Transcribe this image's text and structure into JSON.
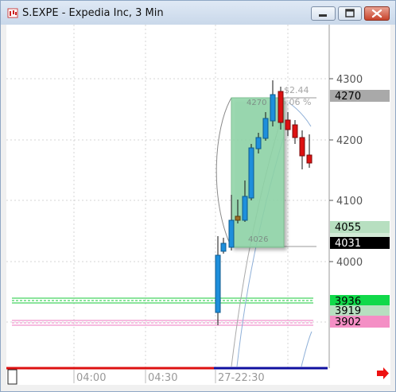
{
  "window": {
    "title": "S.EXPE - Expedia Inc, 3 Min"
  },
  "price_axis": {
    "ticks": [
      "4300",
      "4200",
      "4100",
      "4000"
    ],
    "markers": [
      {
        "label": "4270",
        "value": 4270,
        "bg": "#a9a9a9",
        "fg": "#000000"
      },
      {
        "label": "4055",
        "value": 4055,
        "bg": "#b7dfc0",
        "fg": "#000000"
      },
      {
        "label": "4031",
        "value": 4031,
        "bg": "#000000",
        "fg": "#ffffff"
      },
      {
        "label": "3936",
        "value": 3936,
        "bg": "#11d94a",
        "fg": "#000000"
      },
      {
        "label": "3919",
        "value": 3919,
        "bg": "#b7dfc0",
        "fg": "#000000"
      },
      {
        "label": "3902",
        "value": 3902,
        "bg": "#f48fc5",
        "fg": "#000000"
      }
    ]
  },
  "time_axis": {
    "labels": [
      "04:00",
      "04:30",
      "27-22:30"
    ]
  },
  "annotations": {
    "box_top_label": "4270",
    "box_bottom_label": "4026",
    "gain_label": "$2.44",
    "pct_label": "6.06 %"
  },
  "colors": {
    "up_candle": "#1e8fdc",
    "down_candle": "#dd1111",
    "profit_box": "#8fd6a8",
    "green_level": "#17c93a",
    "pink_level": "#ee7ac2",
    "grid": "#d4d4d4"
  },
  "icons": {
    "app": "chart-app-icon",
    "scroll_right": "red-arrow-right-icon"
  }
}
